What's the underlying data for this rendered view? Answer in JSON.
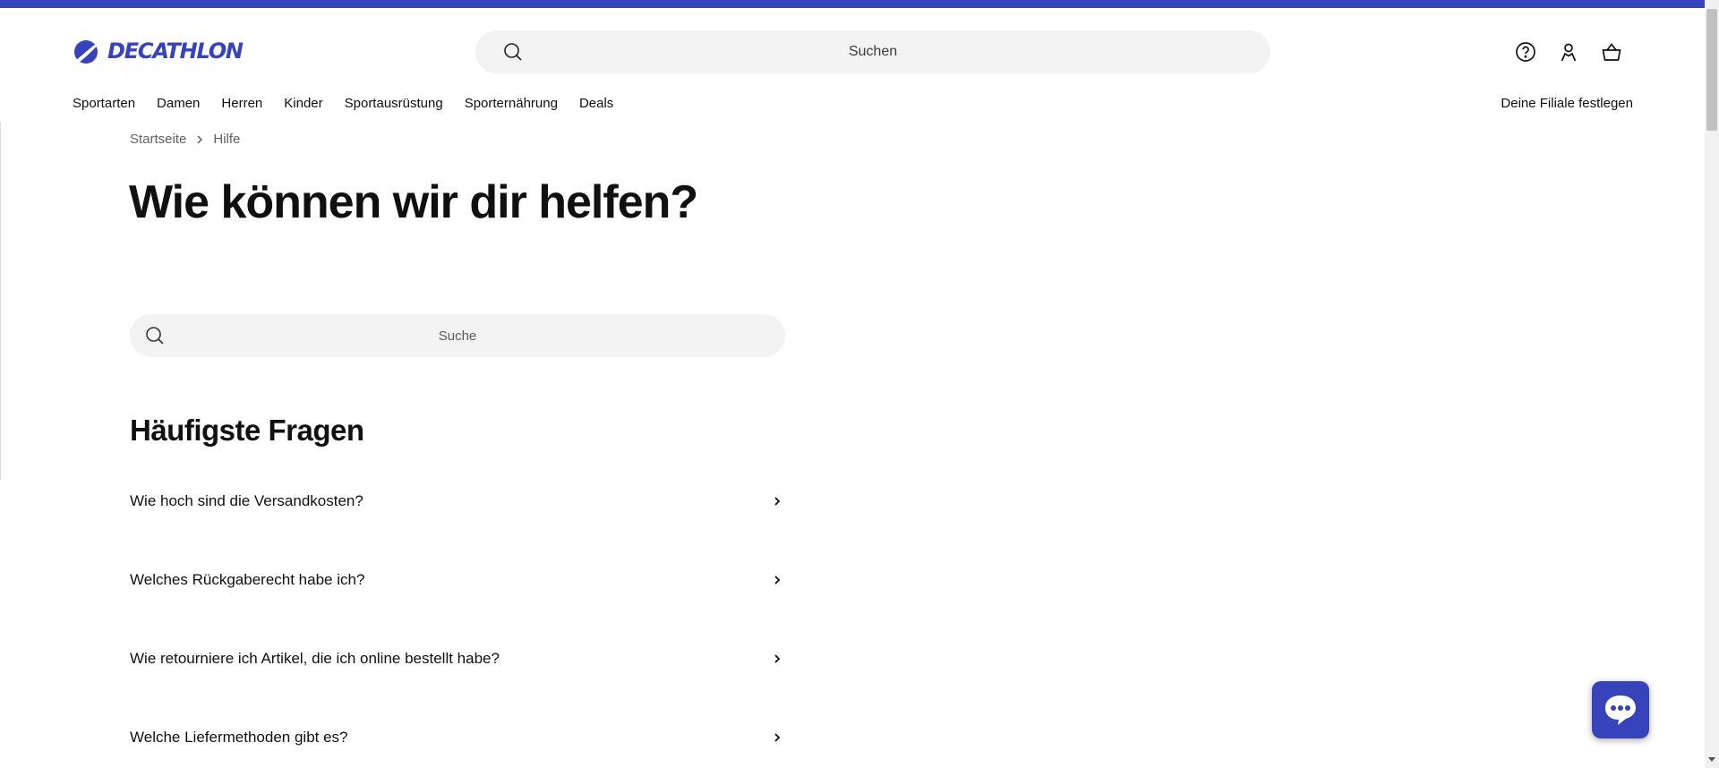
{
  "header": {
    "brand": "DECATHLON",
    "search_placeholder": "Suchen",
    "icons": [
      "help-icon",
      "account-icon",
      "cart-icon"
    ]
  },
  "nav": {
    "items": [
      "Sportarten",
      "Damen",
      "Herren",
      "Kinder",
      "Sportausrüstung",
      "Sporternährung",
      "Deals"
    ],
    "store_label": "Deine Filiale festlegen"
  },
  "breadcrumb": [
    "Startseite",
    "Hilfe"
  ],
  "main": {
    "title": "Wie können wir dir helfen?",
    "search_placeholder": "Suche",
    "faq_title": "Häufigste Fragen",
    "faq": [
      "Wie hoch sind die Versandkosten?",
      "Welches Rückgaberecht habe ich?",
      "Wie retourniere ich Artikel, die ich online bestellt habe?",
      "Welche Liefermethoden gibt es?"
    ]
  },
  "colors": {
    "brand": "#3643ba",
    "search_bg": "#f3f3f3",
    "text": "#101010"
  }
}
